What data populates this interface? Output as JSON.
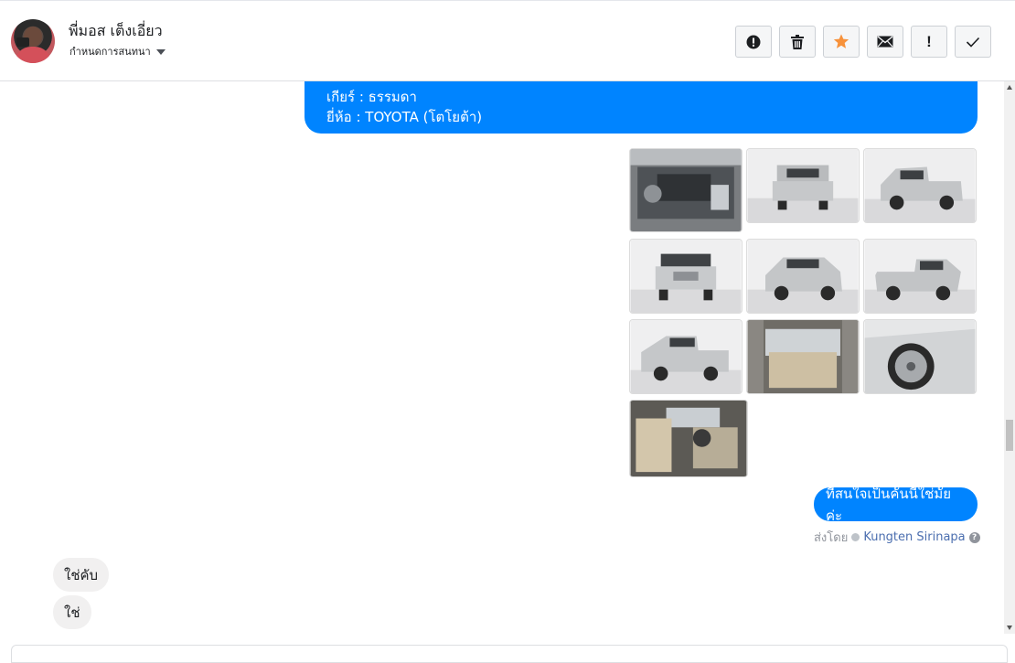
{
  "header": {
    "contact_name": "พี่มอส เต็งเอี่ยว",
    "assign_label": "กำหนดการสนทนา",
    "toolbar_icons": [
      "alert-icon",
      "trash-icon",
      "star-icon",
      "envelope-icon",
      "exclamation-icon",
      "check-icon"
    ],
    "star_color": "#f7923b",
    "exclamation_label": "!"
  },
  "thread": {
    "outgoing_details": {
      "line1": "เกียร์ : ธรรมดา",
      "line2": "ยี่ห้อ : TOYOTA (โตโยต้า)"
    },
    "photo_count": 10,
    "outgoing_question": "ที่สนใจเป็นคันนี้ใช่มั้ยค่ะ",
    "sent_by_label": "ส่งโดย",
    "sent_by_agent": "Kungten Sirinapa",
    "help_label": "?",
    "incoming": [
      {
        "text": "ใช่คับ"
      },
      {
        "text": "ใช่"
      }
    ]
  },
  "colors": {
    "outgoing_bubble": "#0084ff",
    "incoming_bubble": "#f1f0f0"
  }
}
